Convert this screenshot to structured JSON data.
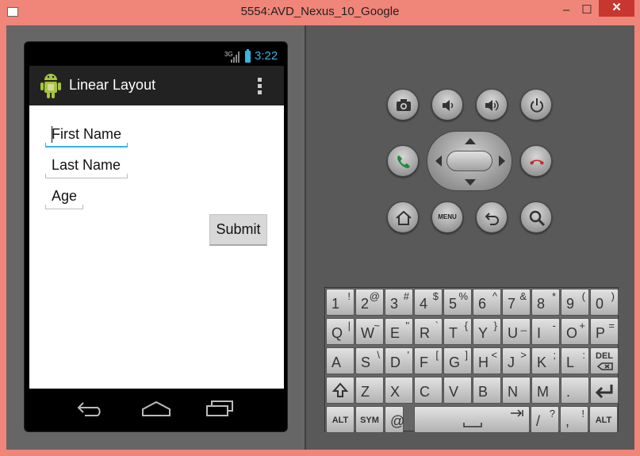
{
  "window": {
    "title": "5554:AVD_Nexus_10_Google",
    "minimize": "–",
    "maximize": "☐",
    "close": "✕"
  },
  "status": {
    "network": "3G",
    "time": "3:22"
  },
  "app": {
    "title": "Linear Layout"
  },
  "form": {
    "first_name_placeholder": "First Name",
    "last_name_placeholder": "Last Name",
    "age_placeholder": "Age",
    "submit_label": "Submit"
  },
  "controls": {
    "menu_label": "MENU"
  },
  "keyboard": {
    "row1": [
      {
        "main": "1",
        "alt": "!"
      },
      {
        "main": "2",
        "alt": "@"
      },
      {
        "main": "3",
        "alt": "#"
      },
      {
        "main": "4",
        "alt": "$"
      },
      {
        "main": "5",
        "alt": "%"
      },
      {
        "main": "6",
        "alt": "^"
      },
      {
        "main": "7",
        "alt": "&"
      },
      {
        "main": "8",
        "alt": "*"
      },
      {
        "main": "9",
        "alt": "("
      },
      {
        "main": "0",
        "alt": ")"
      }
    ],
    "row2": [
      {
        "main": "Q",
        "alt": "|"
      },
      {
        "main": "W",
        "alt": "~"
      },
      {
        "main": "E",
        "alt": "\""
      },
      {
        "main": "R",
        "alt": "`"
      },
      {
        "main": "T",
        "alt": "{"
      },
      {
        "main": "Y",
        "alt": "}"
      },
      {
        "main": "U",
        "alt": "_"
      },
      {
        "main": "I",
        "alt": "-"
      },
      {
        "main": "O",
        "alt": "+"
      },
      {
        "main": "P",
        "alt": "="
      }
    ],
    "row3": [
      {
        "main": "A",
        "alt": ""
      },
      {
        "main": "S",
        "alt": "\\"
      },
      {
        "main": "D",
        "alt": "'"
      },
      {
        "main": "F",
        "alt": "["
      },
      {
        "main": "G",
        "alt": "]"
      },
      {
        "main": "H",
        "alt": "<"
      },
      {
        "main": "J",
        "alt": ">"
      },
      {
        "main": "K",
        "alt": ";"
      },
      {
        "main": "L",
        "alt": ":"
      }
    ],
    "del_label": "DEL",
    "row4": [
      {
        "main": "Z",
        "alt": ""
      },
      {
        "main": "X",
        "alt": ""
      },
      {
        "main": "C",
        "alt": ""
      },
      {
        "main": "V",
        "alt": ""
      },
      {
        "main": "B",
        "alt": ""
      },
      {
        "main": "N",
        "alt": ""
      },
      {
        "main": "M",
        "alt": ""
      },
      {
        "main": ".",
        "alt": ""
      }
    ],
    "alt_label": "ALT",
    "sym_label": "SYM",
    "at_label": "@",
    "slash_main": "/",
    "slash_alt": "?",
    "comma_main": ",",
    "comma_alt": "!"
  }
}
